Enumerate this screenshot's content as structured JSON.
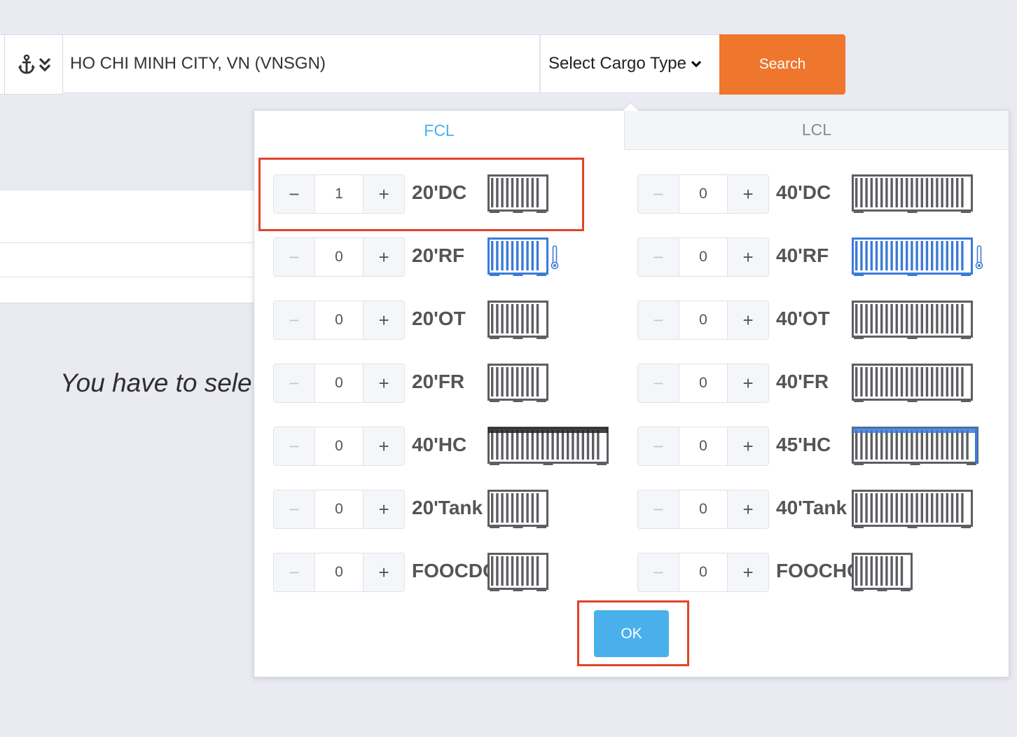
{
  "search_bar": {
    "location_value": "HO CHI MINH CITY, VN (VNSGN)",
    "cargo_select_label": "Select Cargo Type",
    "search_label": "Search"
  },
  "background": {
    "message": "You have to sele"
  },
  "popover": {
    "tabs": [
      {
        "label": "FCL",
        "active": true
      },
      {
        "label": "LCL",
        "active": false
      }
    ],
    "ok_label": "OK",
    "minus_symbol": "−",
    "plus_symbol": "+",
    "containers": [
      {
        "type": "20'DC",
        "qty": "1",
        "icon": "container-gray-icon"
      },
      {
        "type": "40'DC",
        "qty": "0",
        "icon": "container-gray-icon"
      },
      {
        "type": "20'RF",
        "qty": "0",
        "icon": "reefer-container-blue-icon"
      },
      {
        "type": "40'RF",
        "qty": "0",
        "icon": "reefer-container-blue-icon"
      },
      {
        "type": "20'OT",
        "qty": "0",
        "icon": "container-gray-icon"
      },
      {
        "type": "40'OT",
        "qty": "0",
        "icon": "container-gray-icon"
      },
      {
        "type": "20'FR",
        "qty": "0",
        "icon": "container-gray-icon"
      },
      {
        "type": "40'FR",
        "qty": "0",
        "icon": "container-gray-icon"
      },
      {
        "type": "40'HC",
        "qty": "0",
        "icon": "high-cube-container-icon"
      },
      {
        "type": "45'HC",
        "qty": "0",
        "icon": "high-cube-container-blue-icon"
      },
      {
        "type": "20'Tank",
        "qty": "0",
        "icon": "container-gray-icon"
      },
      {
        "type": "40'Tank",
        "qty": "0",
        "icon": "container-gray-icon"
      },
      {
        "type": "FOOCDC",
        "qty": "0",
        "icon": "container-gray-icon"
      },
      {
        "type": "FOOCHC",
        "qty": "0",
        "icon": "container-gray-icon"
      }
    ]
  },
  "colors": {
    "accent_orange": "#ef762d",
    "accent_blue": "#4ab0ec",
    "highlight_red": "#e2422b",
    "container_gray": "#5d5e62",
    "reefer_blue": "#3b7bd6"
  }
}
